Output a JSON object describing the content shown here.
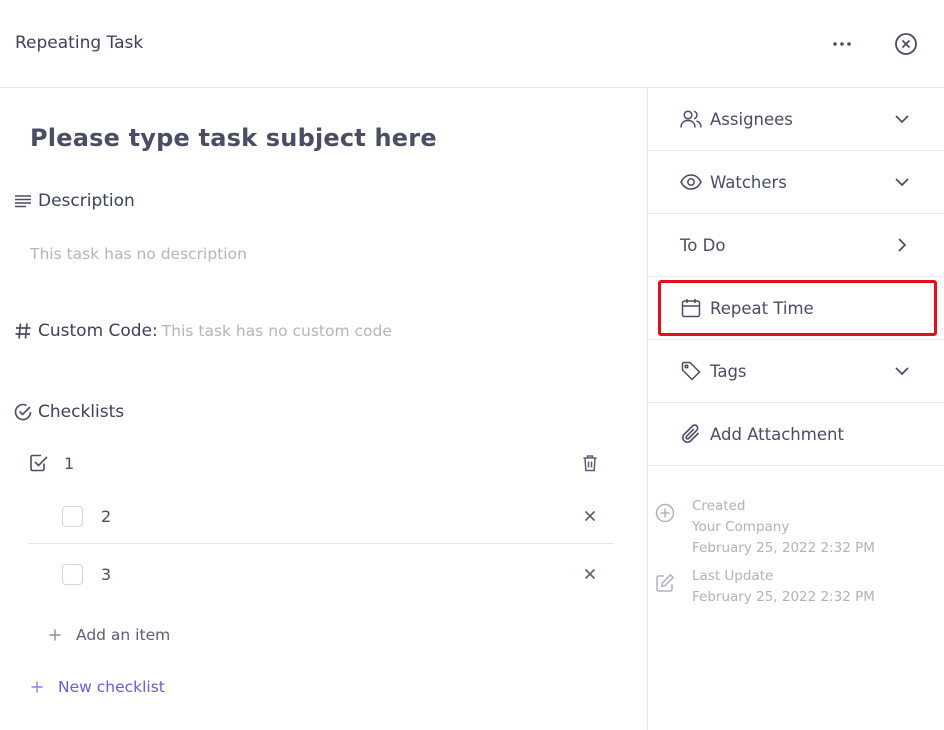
{
  "header": {
    "title": "Repeating Task"
  },
  "task": {
    "subject": "Please type task subject here"
  },
  "description": {
    "label": "Description",
    "placeholder": "This task has no description"
  },
  "custom_code": {
    "label": "Custom Code:",
    "value": "This task has no custom code"
  },
  "checklists": {
    "label": "Checklists",
    "parent": {
      "title": "1",
      "checked": true
    },
    "items": [
      {
        "title": "2",
        "checked": false
      },
      {
        "title": "3",
        "checked": false
      }
    ],
    "add_item_label": "Add an item",
    "new_checklist_label": "New checklist"
  },
  "sidebar": {
    "assignees": "Assignees",
    "watchers": "Watchers",
    "status": "To Do",
    "repeat_time": "Repeat Time",
    "tags": "Tags",
    "attachment": "Add Attachment"
  },
  "meta": {
    "created_label": "Created",
    "created_by": "Your Company",
    "created_at": "February 25, 2022 2:32 PM",
    "updated_label": "Last Update",
    "updated_at": "February 25, 2022 2:32 PM"
  },
  "colors": {
    "accent": "#6b5be0",
    "highlight": "#e0101e"
  },
  "icons": [
    "more-horizontal-icon",
    "close-circle-icon",
    "lines-icon",
    "hash-icon",
    "check-circle-icon",
    "checkbox-checked-icon",
    "trash-icon",
    "x-icon",
    "plus-icon",
    "users-icon",
    "eye-icon",
    "chevron-down-icon",
    "chevron-right-icon",
    "calendar-icon",
    "tag-icon",
    "paperclip-icon",
    "plus-circle-icon",
    "edit-icon"
  ]
}
